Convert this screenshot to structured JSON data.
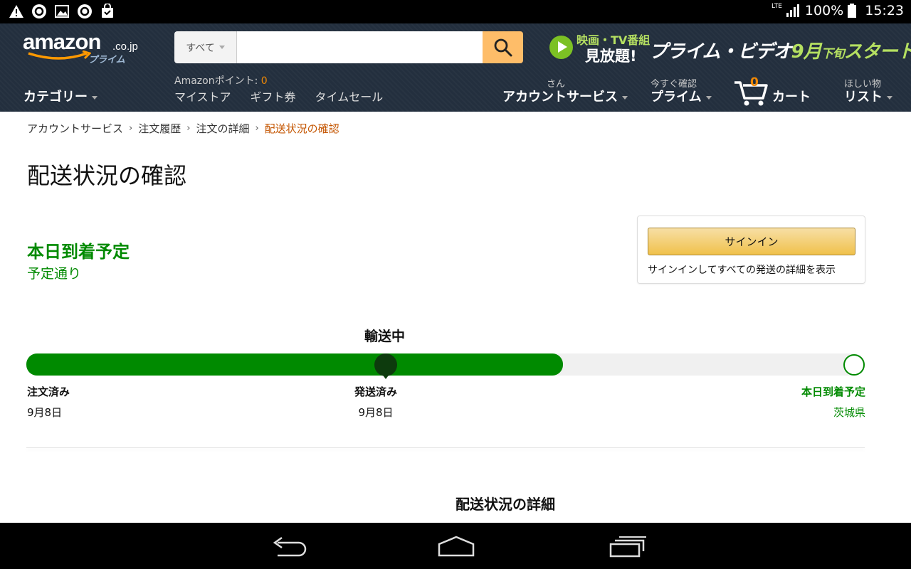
{
  "status_bar": {
    "network": "LTE",
    "battery": "100%",
    "time": "15:23"
  },
  "header": {
    "logo": {
      "word": "amazon",
      "domain": ".co.jp",
      "sub": "プライム"
    },
    "search": {
      "category": "すべて",
      "placeholder": ""
    },
    "promo": {
      "top": "映画・TV番組",
      "bottom": "見放題!",
      "main": "プライム・ビデオ",
      "accent_day": "9月",
      "accent_small": "下旬",
      "accent_end": "スタート"
    },
    "category_label": "カテゴリー",
    "points_label": "Amazonポイント:",
    "points_value": "0",
    "links": [
      "マイストア",
      "ギフト券",
      "タイムセール"
    ],
    "account": {
      "small": "さん",
      "big": "アカウントサービス"
    },
    "prime": {
      "small": "今すぐ確認",
      "big": "プライム"
    },
    "cart": {
      "count": "0",
      "label": "カート"
    },
    "wishlist": {
      "small": "ほしい物",
      "big": "リスト"
    }
  },
  "breadcrumb": [
    "アカウントサービス",
    "注文履歴",
    "注文の詳細",
    "配送状況の確認"
  ],
  "page_title": "配送状況の確認",
  "arrival": {
    "headline": "本日到着予定",
    "sub": "予定通り"
  },
  "signin": {
    "button": "サインイン",
    "note": "サインインしてすべての発送の詳細を表示"
  },
  "tracking": {
    "status": "輸送中",
    "progress_fraction": 0.64,
    "milestones": [
      {
        "label": "注文済み",
        "date": "9月8日"
      },
      {
        "label": "発送済み",
        "date": "9月8日"
      },
      {
        "label": "本日到着予定",
        "date": "茨城県"
      }
    ]
  },
  "details_title": "配送状況の詳細",
  "colors": {
    "header_bg": "#232f3e",
    "accent_orange": "#febd69",
    "success_green": "#008a00",
    "link_orange": "#c45500"
  }
}
